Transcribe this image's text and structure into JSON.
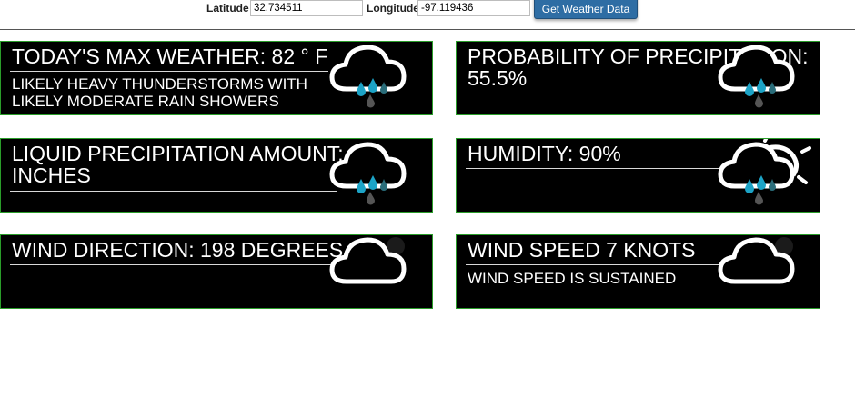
{
  "form": {
    "latitude_label": "Latitude",
    "latitude_value": "32.734511",
    "longitude_label": "Longitude",
    "longitude_value": "-97.119436",
    "submit_label": "Get Weather Data"
  },
  "cards": {
    "max_temp": {
      "title": "TODAY'S MAX WEATHER: 82 ° F",
      "subtitle": "LIKELY HEAVY THUNDERSTORMS WITH LIKELY MODERATE RAIN SHOWERS",
      "icon": "rain-cloud-icon"
    },
    "precip_probability": {
      "title": "PROBABILITY OF PRECIPITATION: 55.5%",
      "icon": "rain-cloud-icon"
    },
    "liquid_precip": {
      "title": "LIQUID PRECIPITATION AMOUNT: 0 INCHES",
      "icon": "rain-cloud-icon"
    },
    "humidity": {
      "title": "HUMIDITY: 90%",
      "icon": "sun-rain-cloud-icon"
    },
    "wind_direction": {
      "title": "WIND DIRECTION: 198 DEGREES",
      "icon": "cloud-icon"
    },
    "wind_speed": {
      "title": "WIND SPEED 7 KNOTS",
      "subtitle": "WIND SPEED IS SUSTAINED",
      "icon": "cloud-icon"
    }
  },
  "colors": {
    "card_background": "#000000",
    "card_border": "#2a9d2a",
    "button_background": "#2e6da4",
    "raindrop_cyan": "#1ca3c6",
    "raindrop_teal": "#2a6d7a",
    "raindrop_gray": "#555555"
  }
}
